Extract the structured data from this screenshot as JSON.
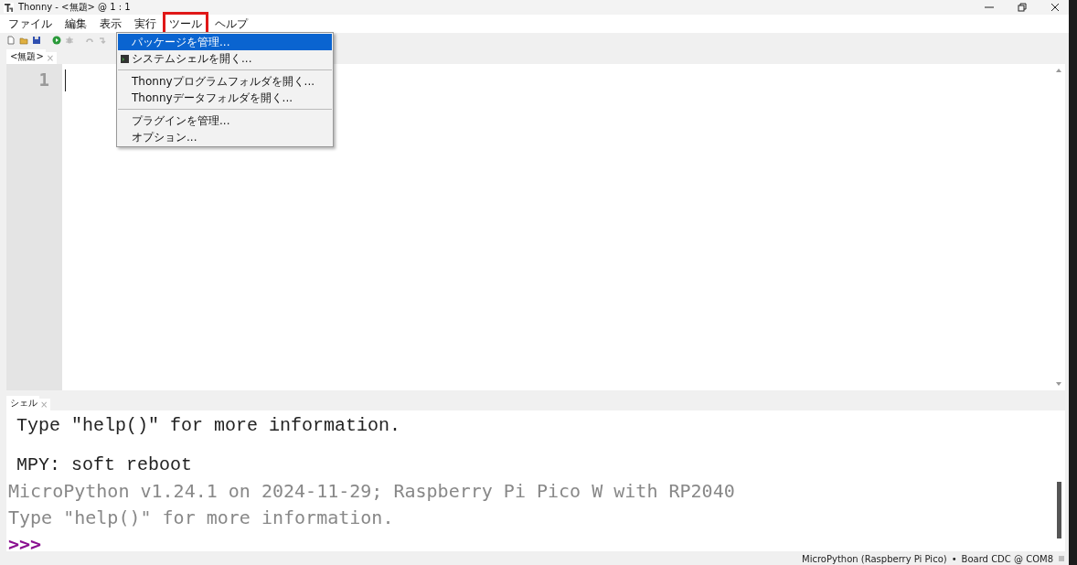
{
  "window": {
    "title": "Thonny  -  <無題>  @  1 : 1"
  },
  "menu": [
    {
      "label": "ファイル",
      "annotated": false
    },
    {
      "label": "編集",
      "annotated": false
    },
    {
      "label": "表示",
      "annotated": false
    },
    {
      "label": "実行",
      "annotated": false
    },
    {
      "label": "ツール",
      "annotated": true
    },
    {
      "label": "ヘルプ",
      "annotated": false
    }
  ],
  "dropdown": [
    {
      "kind": "item",
      "label": "パッケージを管理...",
      "selected": true,
      "icon": false
    },
    {
      "kind": "item",
      "label": "システムシェルを開く...",
      "selected": false,
      "icon": true
    },
    {
      "kind": "separator"
    },
    {
      "kind": "item",
      "label": "Thonnyプログラムフォルダを開く...",
      "selected": false,
      "icon": false
    },
    {
      "kind": "item",
      "label": "Thonnyデータフォルダを開く...",
      "selected": false,
      "icon": false
    },
    {
      "kind": "separator"
    },
    {
      "kind": "item",
      "label": "プラグインを管理...",
      "selected": false,
      "icon": false
    },
    {
      "kind": "item",
      "label": "オプション...",
      "selected": false,
      "icon": false
    }
  ],
  "editor": {
    "tab": "<無題>",
    "tab_close": "×",
    "line_numbers": [
      "1"
    ]
  },
  "shell": {
    "tab": "シェル",
    "tab_close": "×",
    "lines": [
      {
        "kind": "old",
        "text": "Type \"help()\" for more information."
      },
      {
        "kind": "blank"
      },
      {
        "kind": "old",
        "text": "MPY: soft reboot"
      },
      {
        "kind": "new",
        "text": "MicroPython v1.24.1 on 2024-11-29; Raspberry Pi Pico W with RP2040"
      },
      {
        "kind": "new",
        "text": "Type \"help()\" for more information."
      },
      {
        "kind": "prompt",
        "text": ">>>"
      }
    ]
  },
  "status_bar": {
    "interpreter": "MicroPython (Raspberry Pi Pico)",
    "separator": "•",
    "port": "Board CDC @ COM8"
  }
}
